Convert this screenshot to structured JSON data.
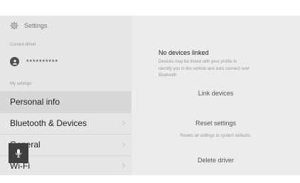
{
  "header": {
    "title": "Settings",
    "icon": "gear-icon"
  },
  "current_driver": {
    "section_label": "Current driver",
    "name": "**********",
    "avatar_icon": "person-icon"
  },
  "my_settings": {
    "section_label": "My settings",
    "items": [
      {
        "label": "Personal info",
        "selected": true
      },
      {
        "label": "Bluetooth & Devices",
        "selected": false
      },
      {
        "label": "General",
        "selected": false
      },
      {
        "label": "Wi-Fi",
        "selected": false
      }
    ]
  },
  "mic_button": {
    "icon": "microphone-icon"
  },
  "main": {
    "no_devices_title": "No devices linked",
    "no_devices_desc": "Devices may be linked with your profile to identify you in the vehicle and auto connect over Bluetooth.",
    "link_devices": "Link devices",
    "reset_settings": "Reset settings",
    "reset_desc": "Resets all settings to system defaults.",
    "delete_driver": "Delete driver"
  }
}
